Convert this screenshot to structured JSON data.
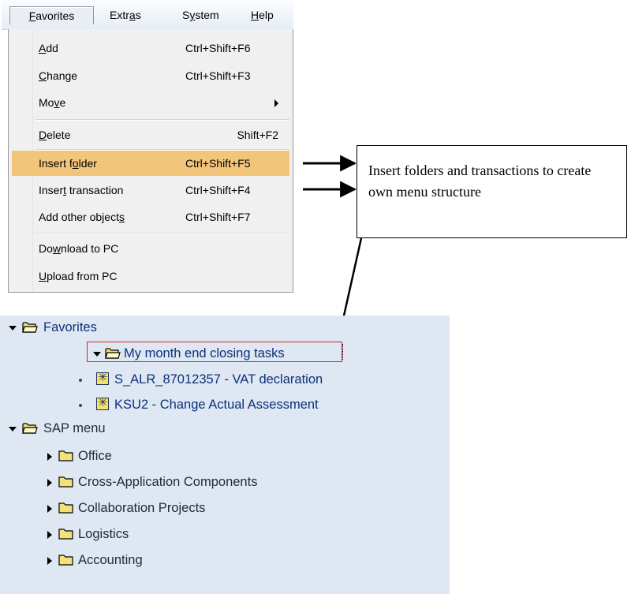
{
  "menubar": {
    "items": [
      {
        "label": "Favorites",
        "active": true
      },
      {
        "label": "Extras"
      },
      {
        "label": "System"
      },
      {
        "label": "Help"
      }
    ]
  },
  "favorites_menu": {
    "items": [
      {
        "label": "Add",
        "shortcut": "Ctrl+Shift+F6"
      },
      {
        "label": "Change",
        "shortcut": "Ctrl+Shift+F3"
      },
      {
        "label": "Move",
        "shortcut": "",
        "submenu": true
      },
      {
        "label": "Delete",
        "shortcut": "Shift+F2"
      },
      {
        "label": "Insert folder",
        "shortcut": "Ctrl+Shift+F5",
        "highlighted": true
      },
      {
        "label": "Insert transaction",
        "shortcut": "Ctrl+Shift+F4"
      },
      {
        "label": "Add other objects",
        "shortcut": "Ctrl+Shift+F7"
      },
      {
        "label": "Download to PC",
        "shortcut": ""
      },
      {
        "label": "Upload from PC",
        "shortcut": ""
      }
    ]
  },
  "callout": {
    "text": "Insert folders and transactions to create own menu structure"
  },
  "tree": {
    "favorites_label": "Favorites",
    "my_folder_label": "My month end closing tasks",
    "transactions": [
      "S_ALR_87012357 - VAT declaration",
      "KSU2 - Change Actual Assessment"
    ],
    "sap_menu_label": "SAP menu",
    "sap_menu_items": [
      "Office",
      "Cross-Application Components",
      "Collaboration Projects",
      "Logistics",
      "Accounting"
    ]
  },
  "colors": {
    "highlight": "#f3c57b",
    "tree_background": "#dfe8f2",
    "tree_text": "#0a2f7a",
    "selection_border": "#e02020"
  }
}
